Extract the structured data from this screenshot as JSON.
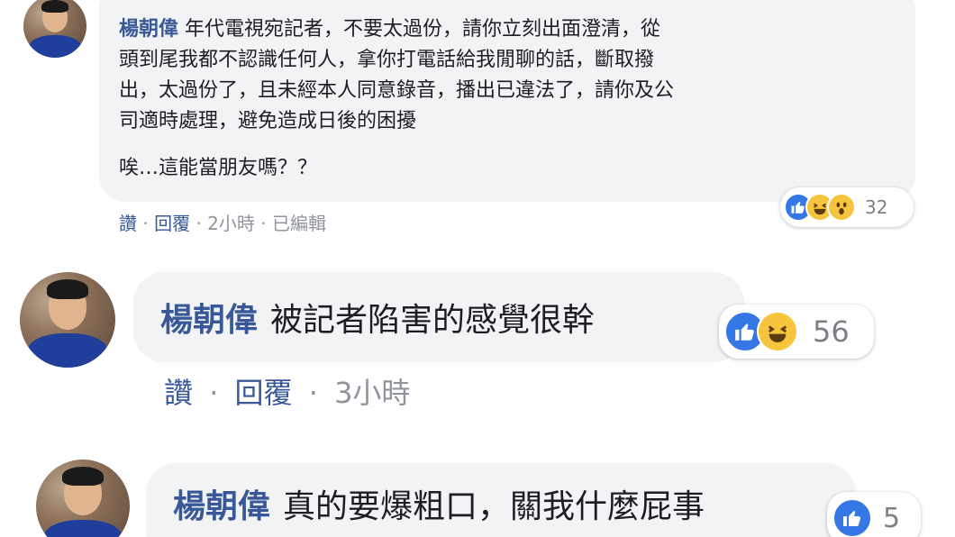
{
  "comments": [
    {
      "author": "楊朝偉",
      "text_lines": [
        "年代電視宛記者，不要太過份，請你立刻出面澄清，從",
        "頭到尾我都不認識任何人，拿你打電話給我閒聊的話，斷取撥",
        "出，太過份了，且未經本人同意錄音，播出已違法了，請你及公",
        "司適時處理，避免造成日後的困擾"
      ],
      "text_extra": "唉…這能當朋友嗎？？",
      "reaction_icons": [
        "like-icon",
        "haha-icon",
        "wow-icon"
      ],
      "reaction_count": "32",
      "actions": {
        "like": "讚",
        "reply": "回覆",
        "time": "2小時",
        "edited": "已編輯",
        "sep": "·"
      }
    },
    {
      "author": "楊朝偉",
      "text": "被記者陷害的感覺很幹",
      "reaction_icons": [
        "like-icon",
        "haha-icon"
      ],
      "reaction_count": "56",
      "actions": {
        "like": "讚",
        "reply": "回覆",
        "time": "3小時",
        "sep": "·"
      }
    },
    {
      "author": "楊朝偉",
      "text": "真的要爆粗口，關我什麼屁事",
      "reaction_icons": [
        "like-icon"
      ],
      "reaction_count": "5"
    }
  ],
  "colors": {
    "author": "#385898",
    "bubble": "#f2f3f5",
    "like": "#3578e5",
    "haha": "#f7c53d",
    "meta": "#90949c"
  }
}
